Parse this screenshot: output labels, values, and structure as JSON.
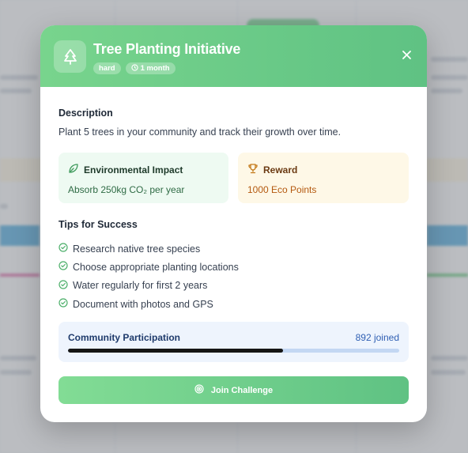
{
  "modal": {
    "title": "Tree Planting Initiative",
    "difficulty": "hard",
    "duration": "1 month",
    "description_heading": "Description",
    "description": "Plant 5 trees in your community and track their growth over time.",
    "impact": {
      "heading": "Environmental Impact",
      "value": "Absorb 250kg CO₂ per year"
    },
    "reward": {
      "heading": "Reward",
      "value": "1000 Eco Points"
    },
    "tips_heading": "Tips for Success",
    "tips": [
      "Research native tree species",
      "Choose appropriate planting locations",
      "Water regularly for first 2 years",
      "Document with photos and GPS"
    ],
    "community": {
      "label": "Community Participation",
      "count": "892 joined",
      "progress": 0.65
    },
    "join_label": "Join Challenge"
  },
  "colors": {
    "header_green": "#6cca88",
    "impact_bg": "#eefaf2",
    "reward_bg": "#fef8e7",
    "community_bg": "#eef4fd",
    "check_green": "#4caf6a"
  },
  "icons": {
    "header": "tree-icon",
    "duration": "clock-icon",
    "close": "close-icon",
    "impact": "leaf-icon",
    "reward": "trophy-icon",
    "tip": "check-circle-icon",
    "join": "target-icon"
  }
}
